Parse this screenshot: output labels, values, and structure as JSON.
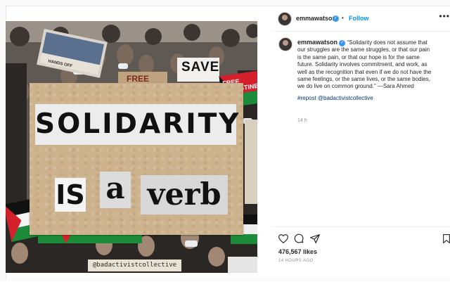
{
  "post": {
    "username": "emmawatson",
    "verified_badge": "✓",
    "follow_label": "Follow",
    "header_separator": "•",
    "more_icon": "more-options-icon",
    "caption_text": "“Solidarity does not assume that our struggles are the same struggles, or that our pain is the same pain, or that our hope is for the same future. Solidarity involves commitment, and work, as well as the recognition that even if we do not have the same feelings, or the same lives, or the same bodies, we do live on common ground.” —Sara Ahmed",
    "hashtag": "#repost @badactivistcollective",
    "caption_time": "14 h",
    "likes": "476,567 likes",
    "time_ago": "14 HOURS AGO"
  },
  "image": {
    "words": [
      "SOLIDARITY",
      "IS",
      "a",
      "verb"
    ],
    "watermark": "@badactivistcollective",
    "signs": {
      "save": "SAVE",
      "free": "FREE",
      "free_palestine": "FREE PALESTINE",
      "hands_off": "HANDS OFF"
    }
  },
  "colors": {
    "link_blue": "#0095f6",
    "card": "#cdb28e",
    "palestine_green": "#1d8c3a",
    "palestine_red": "#d3202b"
  }
}
